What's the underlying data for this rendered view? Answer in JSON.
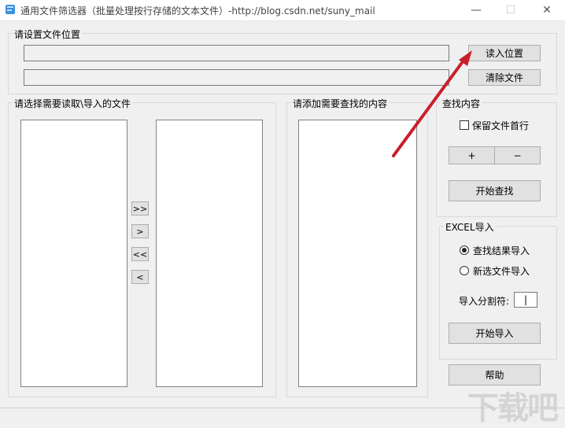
{
  "window": {
    "title": "通用文件筛选器（批量处理按行存储的文本文件）-http://blog.csdn.net/suny_mail",
    "icon": "app-icon",
    "controls": [
      "minimize-icon",
      "maximize-icon",
      "close-icon"
    ]
  },
  "location_group": {
    "label": "请设置文件位置",
    "path_field_1": "",
    "path_field_2": "",
    "read_button": "读入位置",
    "clear_button": "清除文件"
  },
  "files_group": {
    "label": "请选择需要读取\\导入的文件",
    "move_all_right": ">>",
    "move_right": ">",
    "move_all_left": "<<",
    "move_left": "<"
  },
  "content_group": {
    "label": "请添加需要查找的内容"
  },
  "search_group": {
    "label": "查找内容",
    "keep_first_line_label": "保留文件首行",
    "keep_first_line_checked": false,
    "plus_button": "+",
    "minus_button": "−",
    "start_search_button": "开始查找"
  },
  "excel_group": {
    "label": "EXCEL导入",
    "radio_result_label": "查找结果导入",
    "radio_result_selected": true,
    "radio_new_label": "新选文件导入",
    "radio_new_selected": false,
    "separator_label": "导入分割符:",
    "separator_value": "|",
    "start_import_button": "开始导入"
  },
  "help_button": "帮助",
  "watermark": "下载吧",
  "colors": {
    "annotation_arrow": "#c8202b",
    "background": "#f0f0f0"
  }
}
